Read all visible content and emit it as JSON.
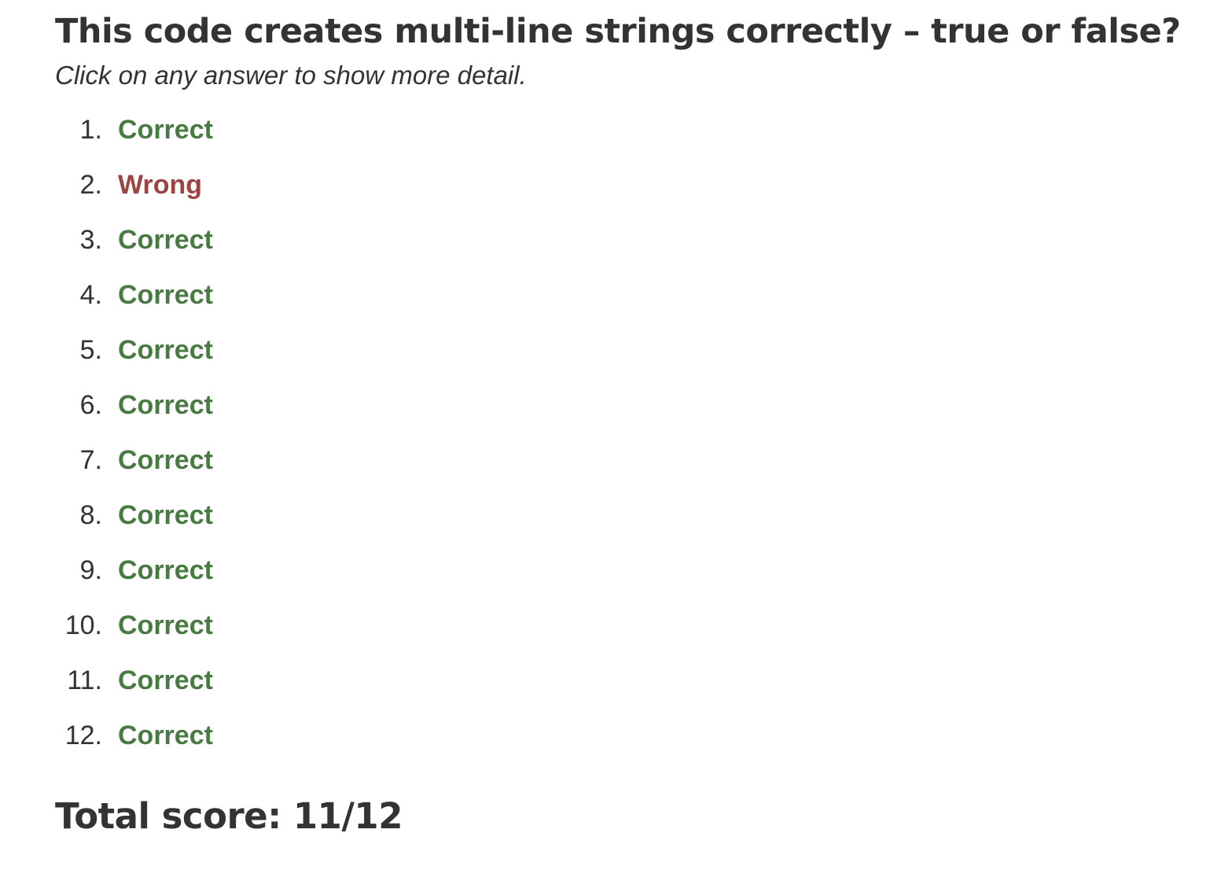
{
  "quiz": {
    "title": "This code creates multi-line strings correctly – true or false?",
    "subtitle": "Click on any answer to show more detail."
  },
  "answers": [
    {
      "number": "1.",
      "label": "Correct",
      "status": "correct"
    },
    {
      "number": "2.",
      "label": "Wrong",
      "status": "wrong"
    },
    {
      "number": "3.",
      "label": "Correct",
      "status": "correct"
    },
    {
      "number": "4.",
      "label": "Correct",
      "status": "correct"
    },
    {
      "number": "5.",
      "label": "Correct",
      "status": "correct"
    },
    {
      "number": "6.",
      "label": "Correct",
      "status": "correct"
    },
    {
      "number": "7.",
      "label": "Correct",
      "status": "correct"
    },
    {
      "number": "8.",
      "label": "Correct",
      "status": "correct"
    },
    {
      "number": "9.",
      "label": "Correct",
      "status": "correct"
    },
    {
      "number": "10.",
      "label": "Correct",
      "status": "correct"
    },
    {
      "number": "11.",
      "label": "Correct",
      "status": "correct"
    },
    {
      "number": "12.",
      "label": "Correct",
      "status": "correct"
    }
  ],
  "score": {
    "text": "Total score: 11/12"
  },
  "colors": {
    "text": "#333333",
    "correct": "#4a7a43",
    "wrong": "#9b4444"
  }
}
